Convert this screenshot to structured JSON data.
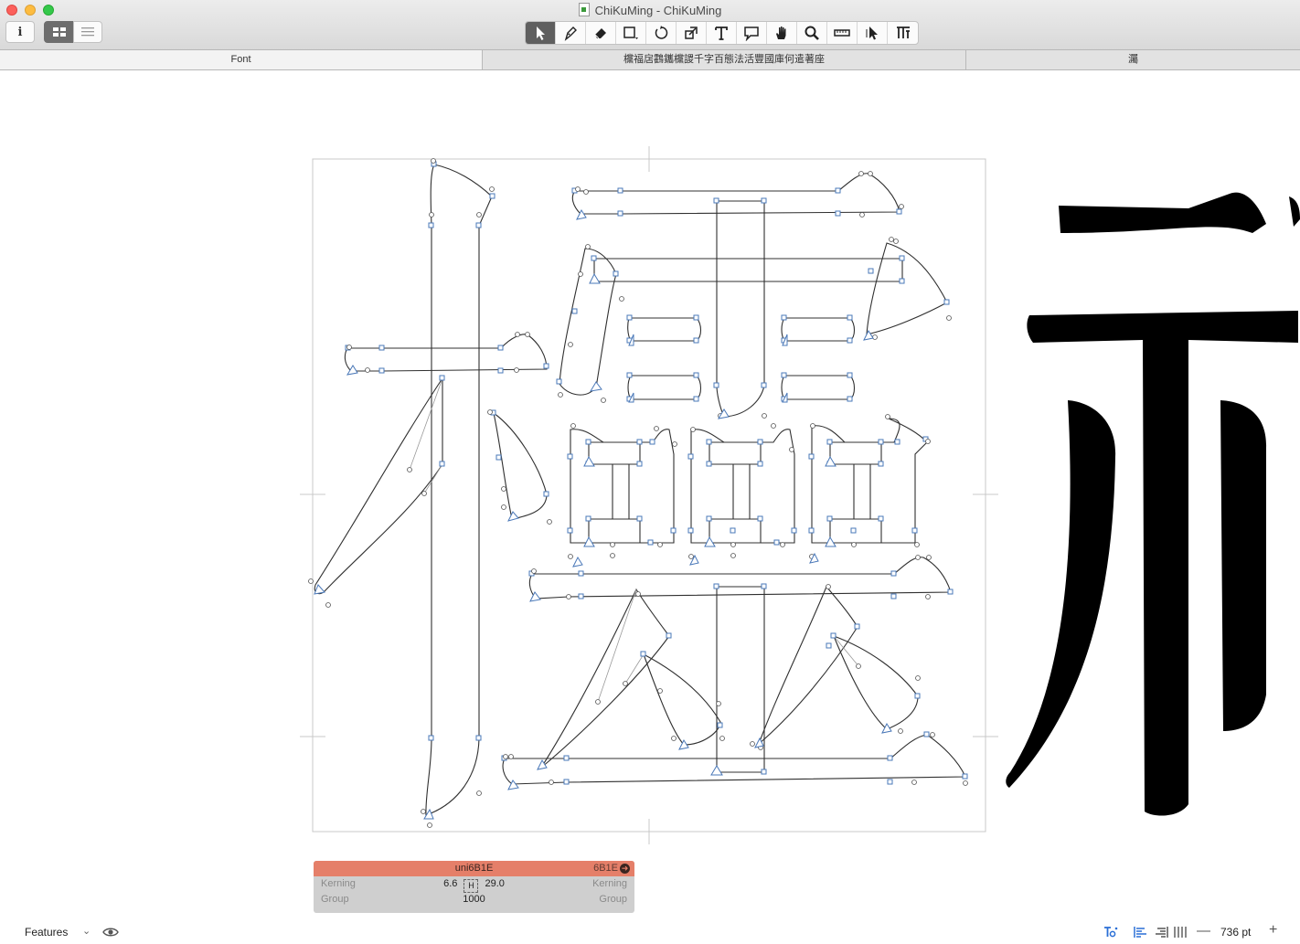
{
  "window": {
    "title": "ChiKuMing - ChiKuMing",
    "info_button": "i"
  },
  "tabs": [
    {
      "label": "Font"
    },
    {
      "label": "欓福扂鸖鑴欓謖千字百態法活豐國庫何遣著座"
    },
    {
      "label": "灟"
    }
  ],
  "toolbar": {
    "tools": [
      "select-tool",
      "pen-tool",
      "eraser-tool",
      "rectangle-tool",
      "rotate-tool",
      "scale-tool",
      "text-tool",
      "annotation-tool",
      "hand-tool",
      "zoom-tool",
      "measure-tool",
      "select-all-layers-tool",
      "smart-tool"
    ],
    "active_tool": "select-tool"
  },
  "glyph_info": {
    "name": "uni6B1E",
    "unicode": "6B1E",
    "left_kerning_label": "Kerning",
    "left_kerning_value": "6.6",
    "right_kerning_value": "29.0",
    "right_kerning_label": "Kerning",
    "left_group_label": "Group",
    "width": "1000",
    "right_group_label": "Group"
  },
  "statusbar": {
    "features_label": "Features",
    "zoom": "736 pt"
  },
  "colors": {
    "glyph_info_header": "#e57f69",
    "node_blue": "#4a78b8",
    "active_tool_bg": "#5f5f5f"
  }
}
